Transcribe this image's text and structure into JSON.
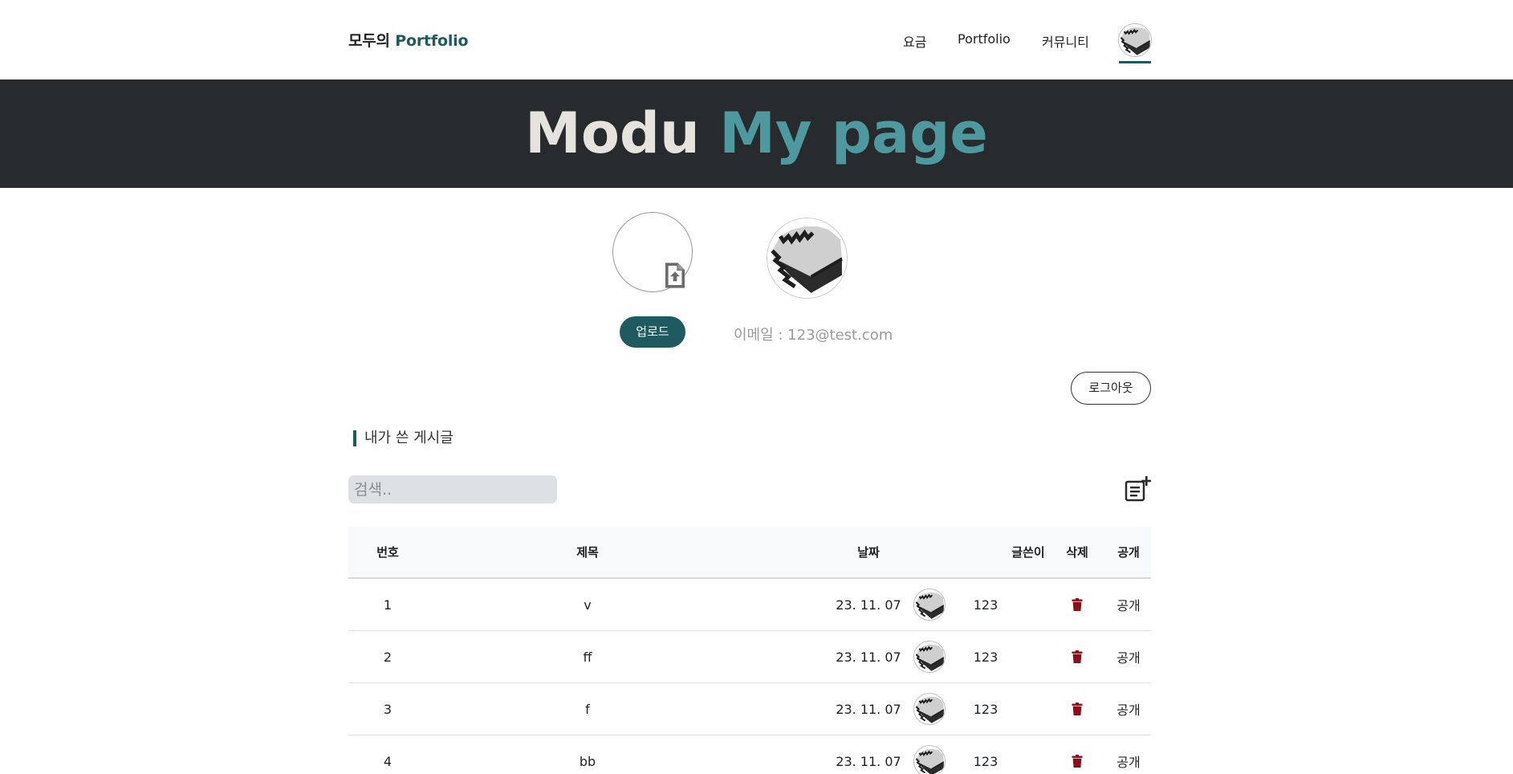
{
  "nav": {
    "brand_prefix": "모두의",
    "brand_accent": "Portfolio",
    "links": [
      "요금",
      "Portfolio",
      "커뮤니티"
    ]
  },
  "banner": {
    "title_part1": "Modu",
    "title_part2": "My page"
  },
  "profile": {
    "upload_label": "업로드",
    "email_text": "이메일 : 123@test.com"
  },
  "actions": {
    "logout_label": "로그아웃"
  },
  "posts": {
    "section_title": "내가 쓴 게시글",
    "search_placeholder": "검색..",
    "headers": {
      "number": "번호",
      "title": "제목",
      "date": "날짜",
      "author": "글쓴이",
      "delete": "삭제",
      "visibility": "공개"
    },
    "rows": [
      {
        "number": "1",
        "title": "v",
        "date": "23. 11. 07",
        "author": "123",
        "visibility": "공개"
      },
      {
        "number": "2",
        "title": "ff",
        "date": "23. 11. 07",
        "author": "123",
        "visibility": "공개"
      },
      {
        "number": "3",
        "title": "f",
        "date": "23. 11. 07",
        "author": "123",
        "visibility": "공개"
      },
      {
        "number": "4",
        "title": "bb",
        "date": "23. 11. 07",
        "author": "123",
        "visibility": "공개"
      }
    ]
  },
  "icons": {
    "avatar": "pixel-hand-cursor-icon",
    "upload": "file-upload-icon",
    "write": "post-add-icon",
    "delete": "trash-icon"
  },
  "colors": {
    "accent": "#1f5a60",
    "banner_bg": "#272b2d",
    "banner_accent": "#4e98a0",
    "delete": "#8b0e1a"
  }
}
